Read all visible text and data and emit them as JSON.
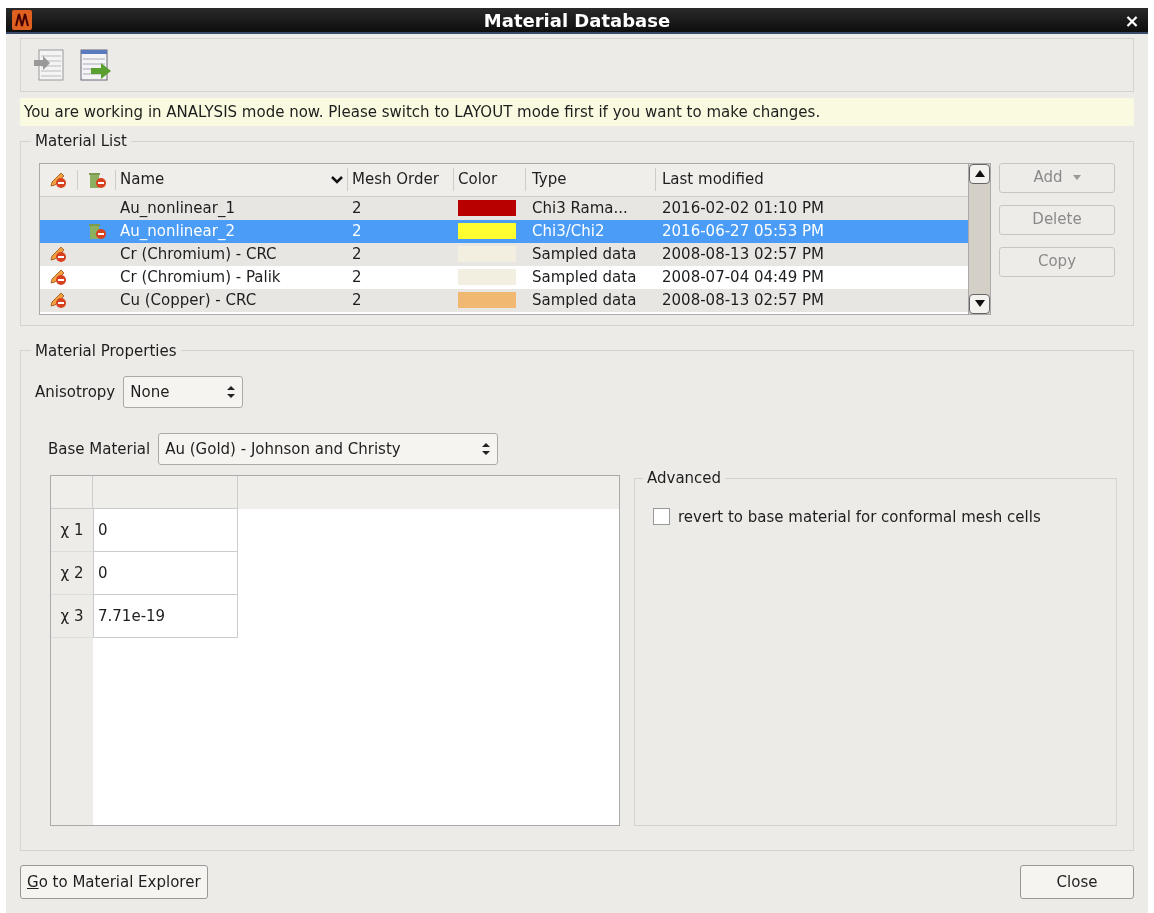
{
  "window": {
    "title": "Material Database",
    "close": "×"
  },
  "notice": "You are working in ANALYSIS mode now. Please switch to LAYOUT mode first if you want to make changes.",
  "material_list": {
    "title": "Material List",
    "columns": [
      "Name",
      "Mesh Order",
      "Color",
      "Type",
      "Last modified"
    ],
    "rows": [
      {
        "kind": "plain",
        "name": "Au_nonlinear_1",
        "mesh_order": "2",
        "color": "#b80000",
        "type": "Chi3 Rama...",
        "modified": "2016-02-02 01:10 PM",
        "selected": false
      },
      {
        "kind": "deletable",
        "name": "Au_nonlinear_2",
        "mesh_order": "2",
        "color": "#ffff30",
        "type": "Chi3/Chi2",
        "modified": "2016-06-27 05:53 PM",
        "selected": true
      },
      {
        "kind": "locked",
        "name": "Cr (Chromium) - CRC",
        "mesh_order": "2",
        "color": "#f2eee0",
        "type": "Sampled data",
        "modified": "2008-08-13 02:57 PM",
        "selected": false
      },
      {
        "kind": "locked",
        "name": "Cr (Chromium) - Palik",
        "mesh_order": "2",
        "color": "#f2eee0",
        "type": "Sampled data",
        "modified": "2008-07-04 04:49 PM",
        "selected": false
      },
      {
        "kind": "locked",
        "name": "Cu (Copper) - CRC",
        "mesh_order": "2",
        "color": "#f0b870",
        "type": "Sampled data",
        "modified": "2008-08-13 02:57 PM",
        "selected": false
      }
    ],
    "buttons": [
      {
        "label": "Add",
        "dropdown": true
      },
      {
        "label": "Delete",
        "dropdown": false
      },
      {
        "label": "Copy",
        "dropdown": false
      }
    ]
  },
  "material_properties": {
    "title": "Material Properties",
    "anisotropy": {
      "label": "Anisotropy",
      "value": "None"
    },
    "base_material": {
      "label": "Base Material",
      "value": "Au (Gold) - Johnson and Christy"
    },
    "chi_table": [
      {
        "label": "χ 1",
        "value": "0"
      },
      {
        "label": "χ 2",
        "value": "0"
      },
      {
        "label": "χ 3",
        "value": "7.71e-19"
      }
    ],
    "advanced": {
      "title": "Advanced",
      "option": {
        "label": "revert to base material for conformal mesh cells",
        "checked": false
      }
    }
  },
  "footer": {
    "left_button": "Go to Material Explorer",
    "right_button": "Close"
  }
}
